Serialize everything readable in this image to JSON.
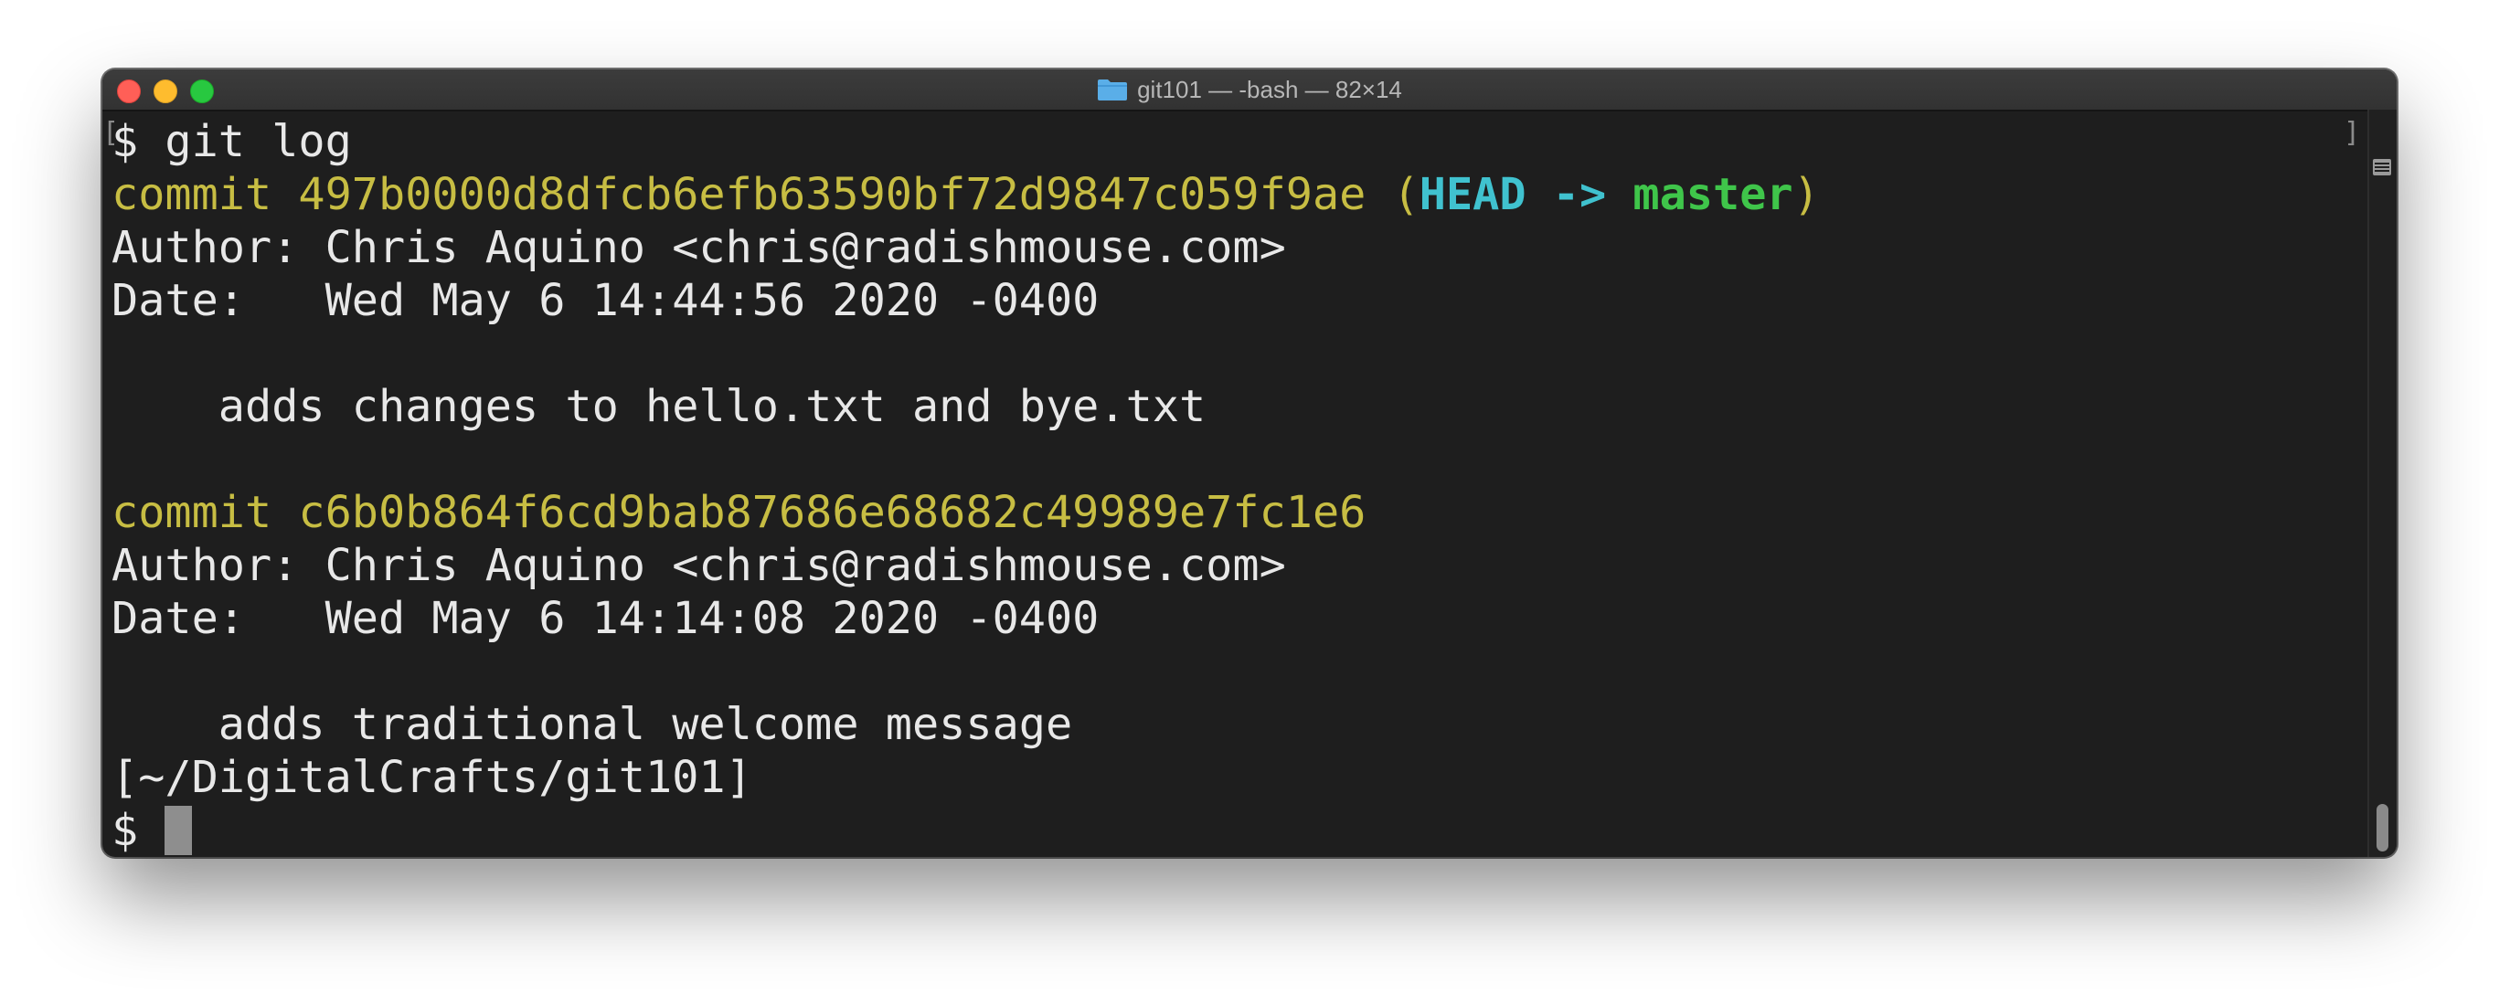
{
  "window": {
    "title": "git101 — -bash — 82×14",
    "title_icon": "folder-icon",
    "controls": [
      "close",
      "minimize",
      "zoom"
    ]
  },
  "terminal": {
    "lines": [
      [
        {
          "text": "$ git log",
          "style": "default"
        }
      ],
      [
        {
          "text": "commit 497b0000d8dfcb6efb63590bf72d9847c059f9ae ",
          "style": "yellow"
        },
        {
          "text": "(",
          "style": "yellow"
        },
        {
          "text": "HEAD -> ",
          "style": "cyan"
        },
        {
          "text": "master",
          "style": "green"
        },
        {
          "text": ")",
          "style": "yellow"
        }
      ],
      [
        {
          "text": "Author: Chris Aquino <chris@radishmouse.com>",
          "style": "default"
        }
      ],
      [
        {
          "text": "Date:   Wed May 6 14:44:56 2020 -0400",
          "style": "default"
        }
      ],
      [
        {
          "text": "",
          "style": "default"
        }
      ],
      [
        {
          "text": "    adds changes to hello.txt and bye.txt",
          "style": "default"
        }
      ],
      [
        {
          "text": "",
          "style": "default"
        }
      ],
      [
        {
          "text": "commit c6b0b864f6cd9bab87686e68682c49989e7fc1e6",
          "style": "yellow"
        }
      ],
      [
        {
          "text": "Author: Chris Aquino <chris@radishmouse.com>",
          "style": "default"
        }
      ],
      [
        {
          "text": "Date:   Wed May 6 14:14:08 2020 -0400",
          "style": "default"
        }
      ],
      [
        {
          "text": "",
          "style": "default"
        }
      ],
      [
        {
          "text": "    adds traditional welcome message",
          "style": "default"
        }
      ],
      [
        {
          "text": "[~/DigitalCrafts/git101]",
          "style": "default"
        }
      ],
      [
        {
          "text": "$ ",
          "style": "default"
        }
      ]
    ],
    "cursor": "block"
  },
  "colors": {
    "background": "#1e1e1e",
    "text": "#e8e8e8",
    "commit_hash": "#c7bd43",
    "head": "#40c2cf",
    "branch": "#3fc54a",
    "close": "#ff5f57",
    "minimize": "#febc2e",
    "zoom": "#28c840"
  }
}
